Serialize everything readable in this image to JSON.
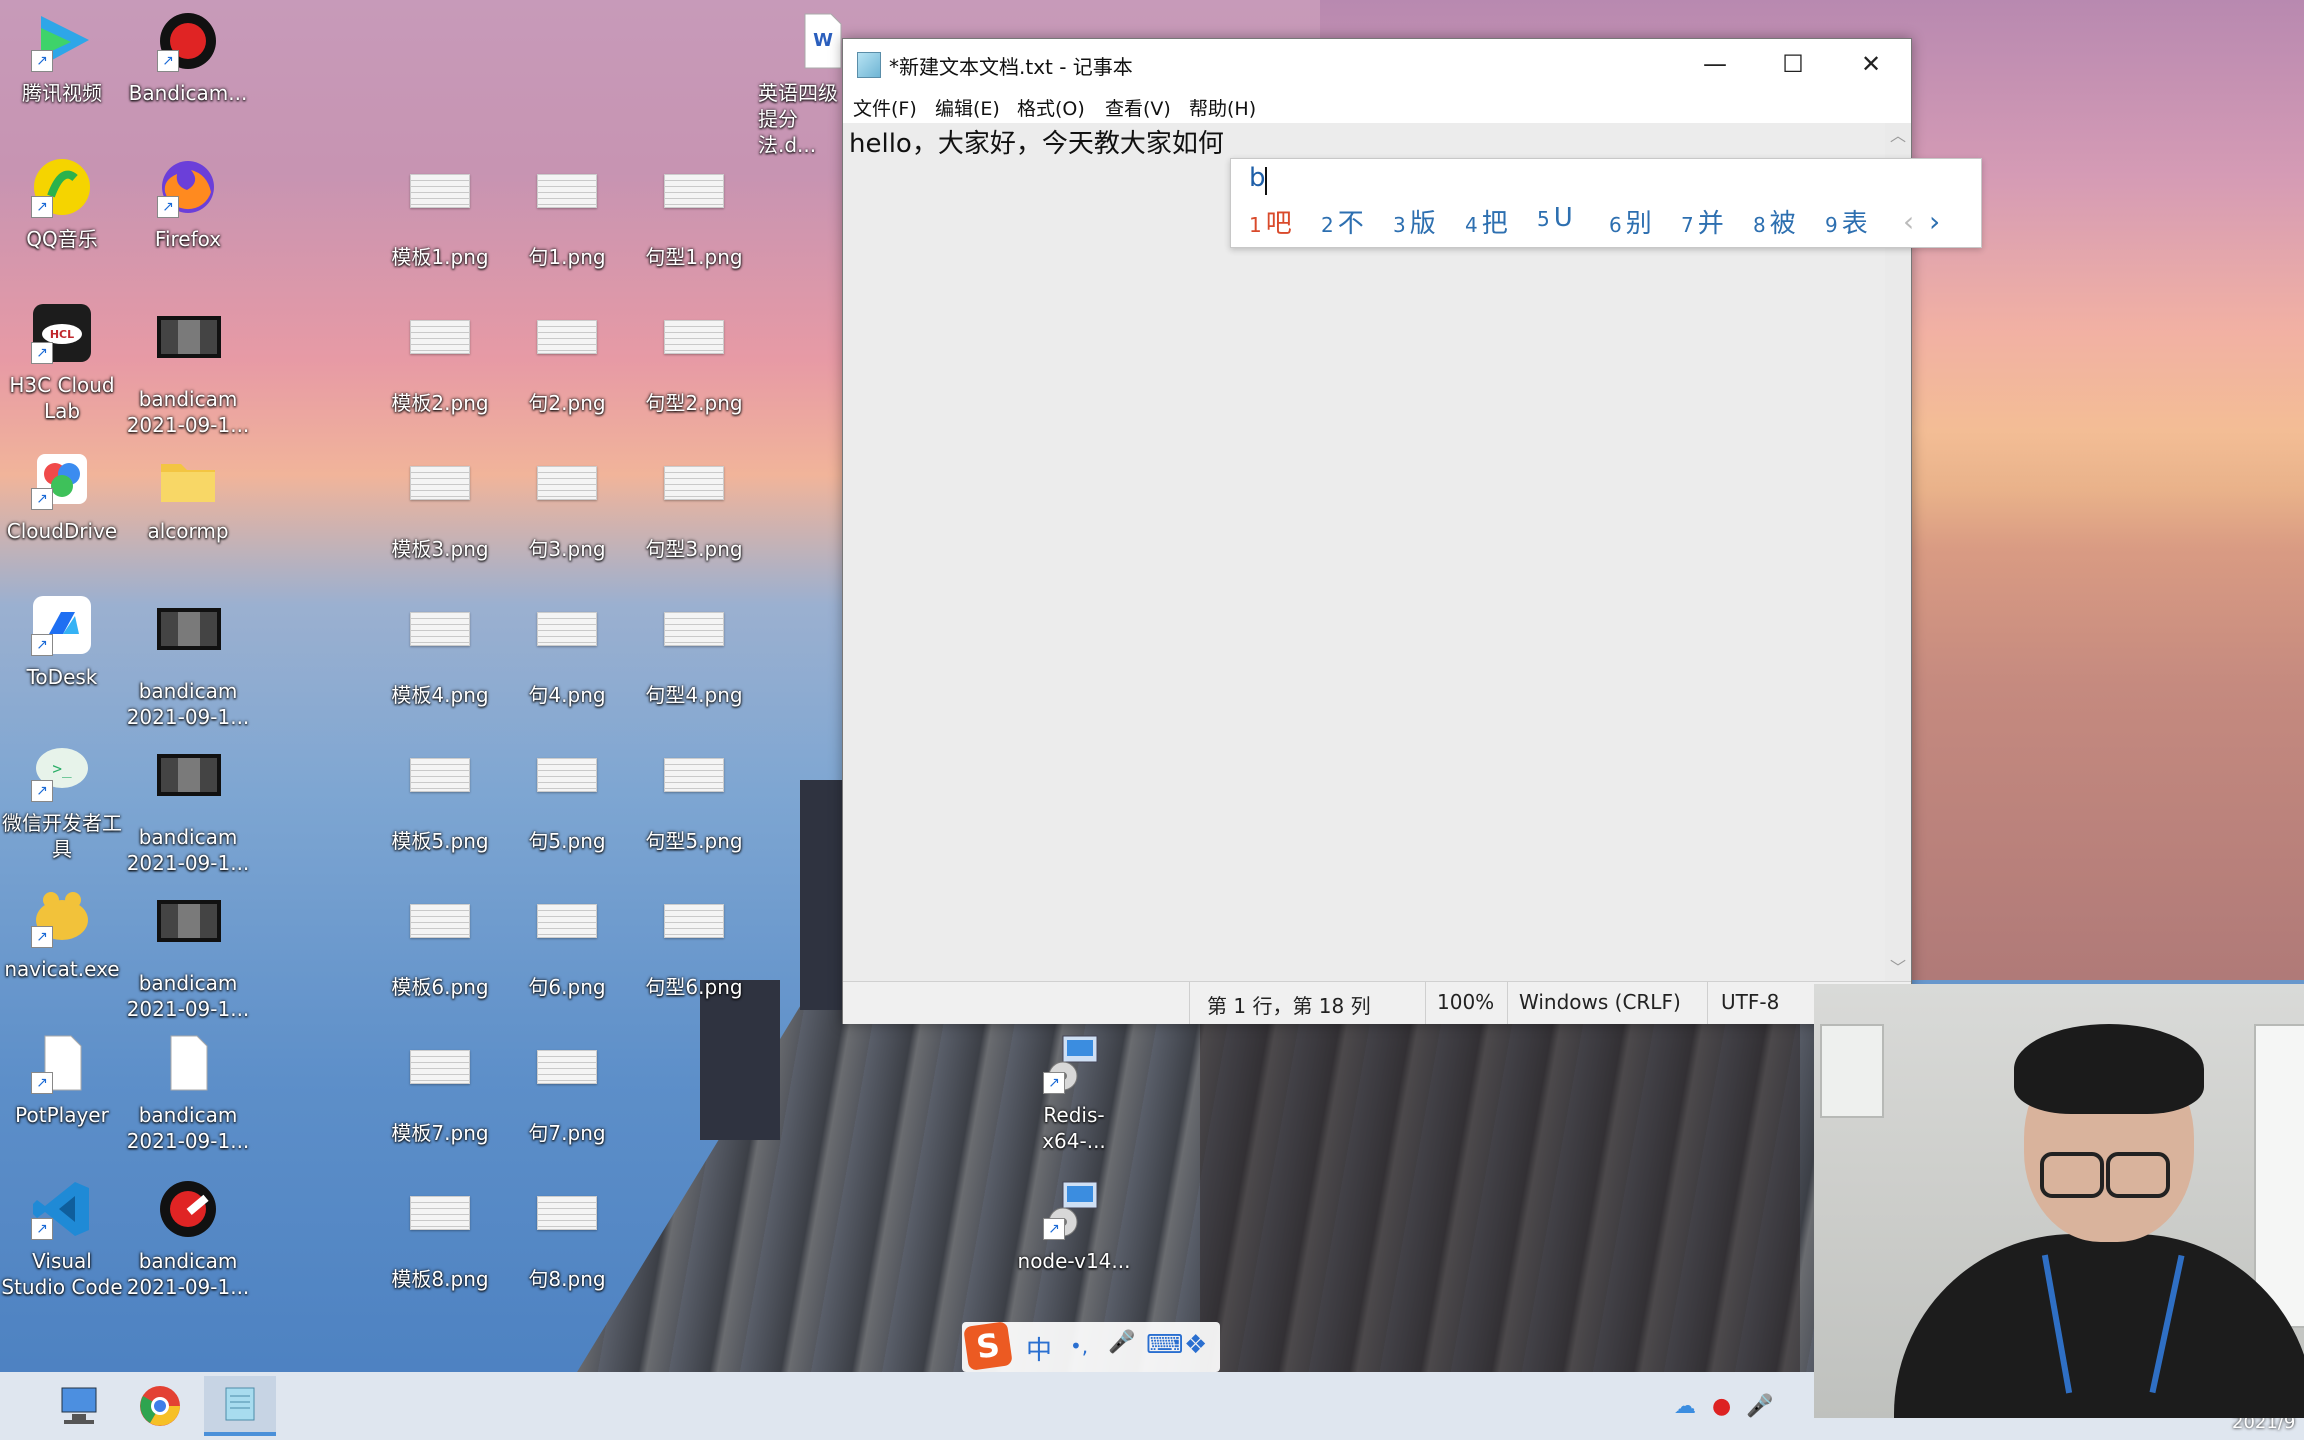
{
  "desktop": {
    "icons": [
      {
        "label": "腾讯视频",
        "icon": "tencent-video-icon"
      },
      {
        "label": "Bandicam...",
        "icon": "bandicam-icon"
      },
      {
        "label": "QQ音乐",
        "icon": "qq-music-icon"
      },
      {
        "label": "Firefox",
        "icon": "firefox-icon"
      },
      {
        "label": "H3C Cloud Lab",
        "icon": "h3c-cloud-lab-icon"
      },
      {
        "label": "bandicam 2021-09-1...",
        "icon": "video-file-icon"
      },
      {
        "label": "CloudDrive",
        "icon": "clouddrive-icon"
      },
      {
        "label": "alcormp",
        "icon": "folder-icon"
      },
      {
        "label": "ToDesk",
        "icon": "todesk-icon"
      },
      {
        "label": "bandicam 2021-09-1...",
        "icon": "video-file-icon"
      },
      {
        "label": "微信开发者工具",
        "icon": "wechat-devtools-icon"
      },
      {
        "label": "bandicam 2021-09-1...",
        "icon": "video-file-icon"
      },
      {
        "label": "navicat.exe",
        "icon": "navicat-icon"
      },
      {
        "label": "bandicam 2021-09-1...",
        "icon": "video-file-icon"
      },
      {
        "label": "PotPlayer",
        "icon": "potplayer-icon"
      },
      {
        "label": "bandicam 2021-09-1...",
        "icon": "file-icon"
      },
      {
        "label": "Visual Studio Code",
        "icon": "vscode-icon"
      },
      {
        "label": "bandicam 2021-09-1...",
        "icon": "bandicam-settings-icon"
      }
    ],
    "png_files": [
      "模板1.png",
      "句1.png",
      "句型1.png",
      "模板2.png",
      "句2.png",
      "句型2.png",
      "模板3.png",
      "句3.png",
      "句型3.png",
      "模板4.png",
      "句4.png",
      "句型4.png",
      "模板5.png",
      "句5.png",
      "句型5.png",
      "模板6.png",
      "句6.png",
      "句型6.png",
      "模板7.png",
      "句7.png",
      "模板8.png",
      "句8.png"
    ],
    "word_doc_label": "英语四级提分法.d...",
    "redis_label": "Redis-x64-...",
    "node_label": "node-v14..."
  },
  "notepad": {
    "title": "*新建文本文档.txt - 记事本",
    "menu": [
      "文件(F)",
      "编辑(E)",
      "格式(O)",
      "查看(V)",
      "帮助(H)"
    ],
    "content": "hello，大家好，今天教大家如何",
    "status": {
      "position": "第 1 行，第 18 列",
      "zoom": "100%",
      "line_ending": "Windows (CRLF)",
      "encoding": "UTF-8"
    },
    "controls": {
      "minimize": "—",
      "maximize": "☐",
      "close": "✕"
    }
  },
  "ime": {
    "input": "b",
    "candidates": [
      {
        "n": "1",
        "text": "吧"
      },
      {
        "n": "2",
        "text": "不"
      },
      {
        "n": "3",
        "text": "版"
      },
      {
        "n": "4",
        "text": "把"
      },
      {
        "n": "5",
        "text": "U"
      },
      {
        "n": "6",
        "text": "别"
      },
      {
        "n": "7",
        "text": "并"
      },
      {
        "n": "8",
        "text": "被"
      },
      {
        "n": "9",
        "text": "表"
      }
    ],
    "prev": "‹",
    "next": "›"
  },
  "sogou_toolbar": {
    "logo": "S",
    "mode": "中",
    "punct": "•,",
    "mic": "🎤",
    "keyboard": "⌨",
    "grid": "❖"
  },
  "taskbar": {
    "clock": "2021/9"
  }
}
